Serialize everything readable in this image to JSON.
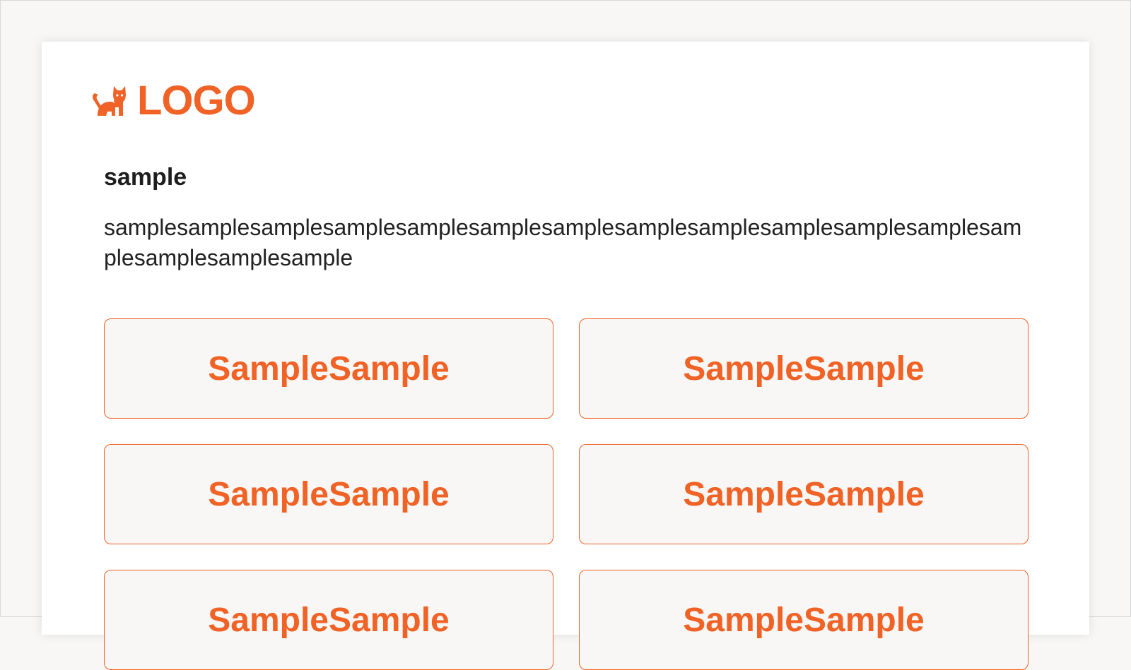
{
  "colors": {
    "accent": "#f06225",
    "page_background": "#f8f7f5",
    "card_background": "#ffffff",
    "text": "#222222"
  },
  "logo": {
    "icon": "cat-icon",
    "text": "LOGO"
  },
  "section": {
    "heading": "sample",
    "description": "samplesamplesamplesamplesamplesamplesamplesamplesamplesamplesamplesamplesamplesamplesamplesample"
  },
  "buttons": [
    {
      "label": "SampleSample"
    },
    {
      "label": "SampleSample"
    },
    {
      "label": "SampleSample"
    },
    {
      "label": "SampleSample"
    },
    {
      "label": "SampleSample"
    },
    {
      "label": "SampleSample"
    }
  ]
}
